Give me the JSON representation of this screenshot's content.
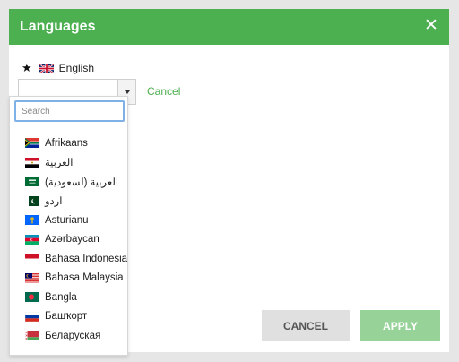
{
  "dialog": {
    "title": "Languages",
    "close_icon": "close-icon",
    "accent_color": "#4caf50"
  },
  "current_language": {
    "star_icon": "star-icon",
    "flag_icon": "flag-uk-icon",
    "label": "English"
  },
  "selector": {
    "value": "",
    "arrow_icon": "chevron-down-icon",
    "cancel_link": "Cancel"
  },
  "dropdown": {
    "search_placeholder": "Search",
    "items": [
      {
        "label": "Afrikaans",
        "flag": "flag-za-icon"
      },
      {
        "label": "العربية",
        "flag": "flag-eg-icon"
      },
      {
        "label": "العربية (لسعودية)",
        "flag": "flag-sa-icon"
      },
      {
        "label": "اردو",
        "flag": "flag-pk-icon"
      },
      {
        "label": "Asturianu",
        "flag": "flag-asturias-icon"
      },
      {
        "label": "Azərbaycan",
        "flag": "flag-az-icon"
      },
      {
        "label": "Bahasa Indonesia",
        "flag": "flag-id-icon"
      },
      {
        "label": "Bahasa Malaysia",
        "flag": "flag-my-icon"
      },
      {
        "label": "Bangla",
        "flag": "flag-bd-icon"
      },
      {
        "label": "Башҡорт",
        "flag": "flag-ru-icon"
      },
      {
        "label": "Беларуская",
        "flag": "flag-by-icon"
      }
    ]
  },
  "footer": {
    "cancel_label": "CANCEL",
    "apply_label": "APPLY"
  }
}
